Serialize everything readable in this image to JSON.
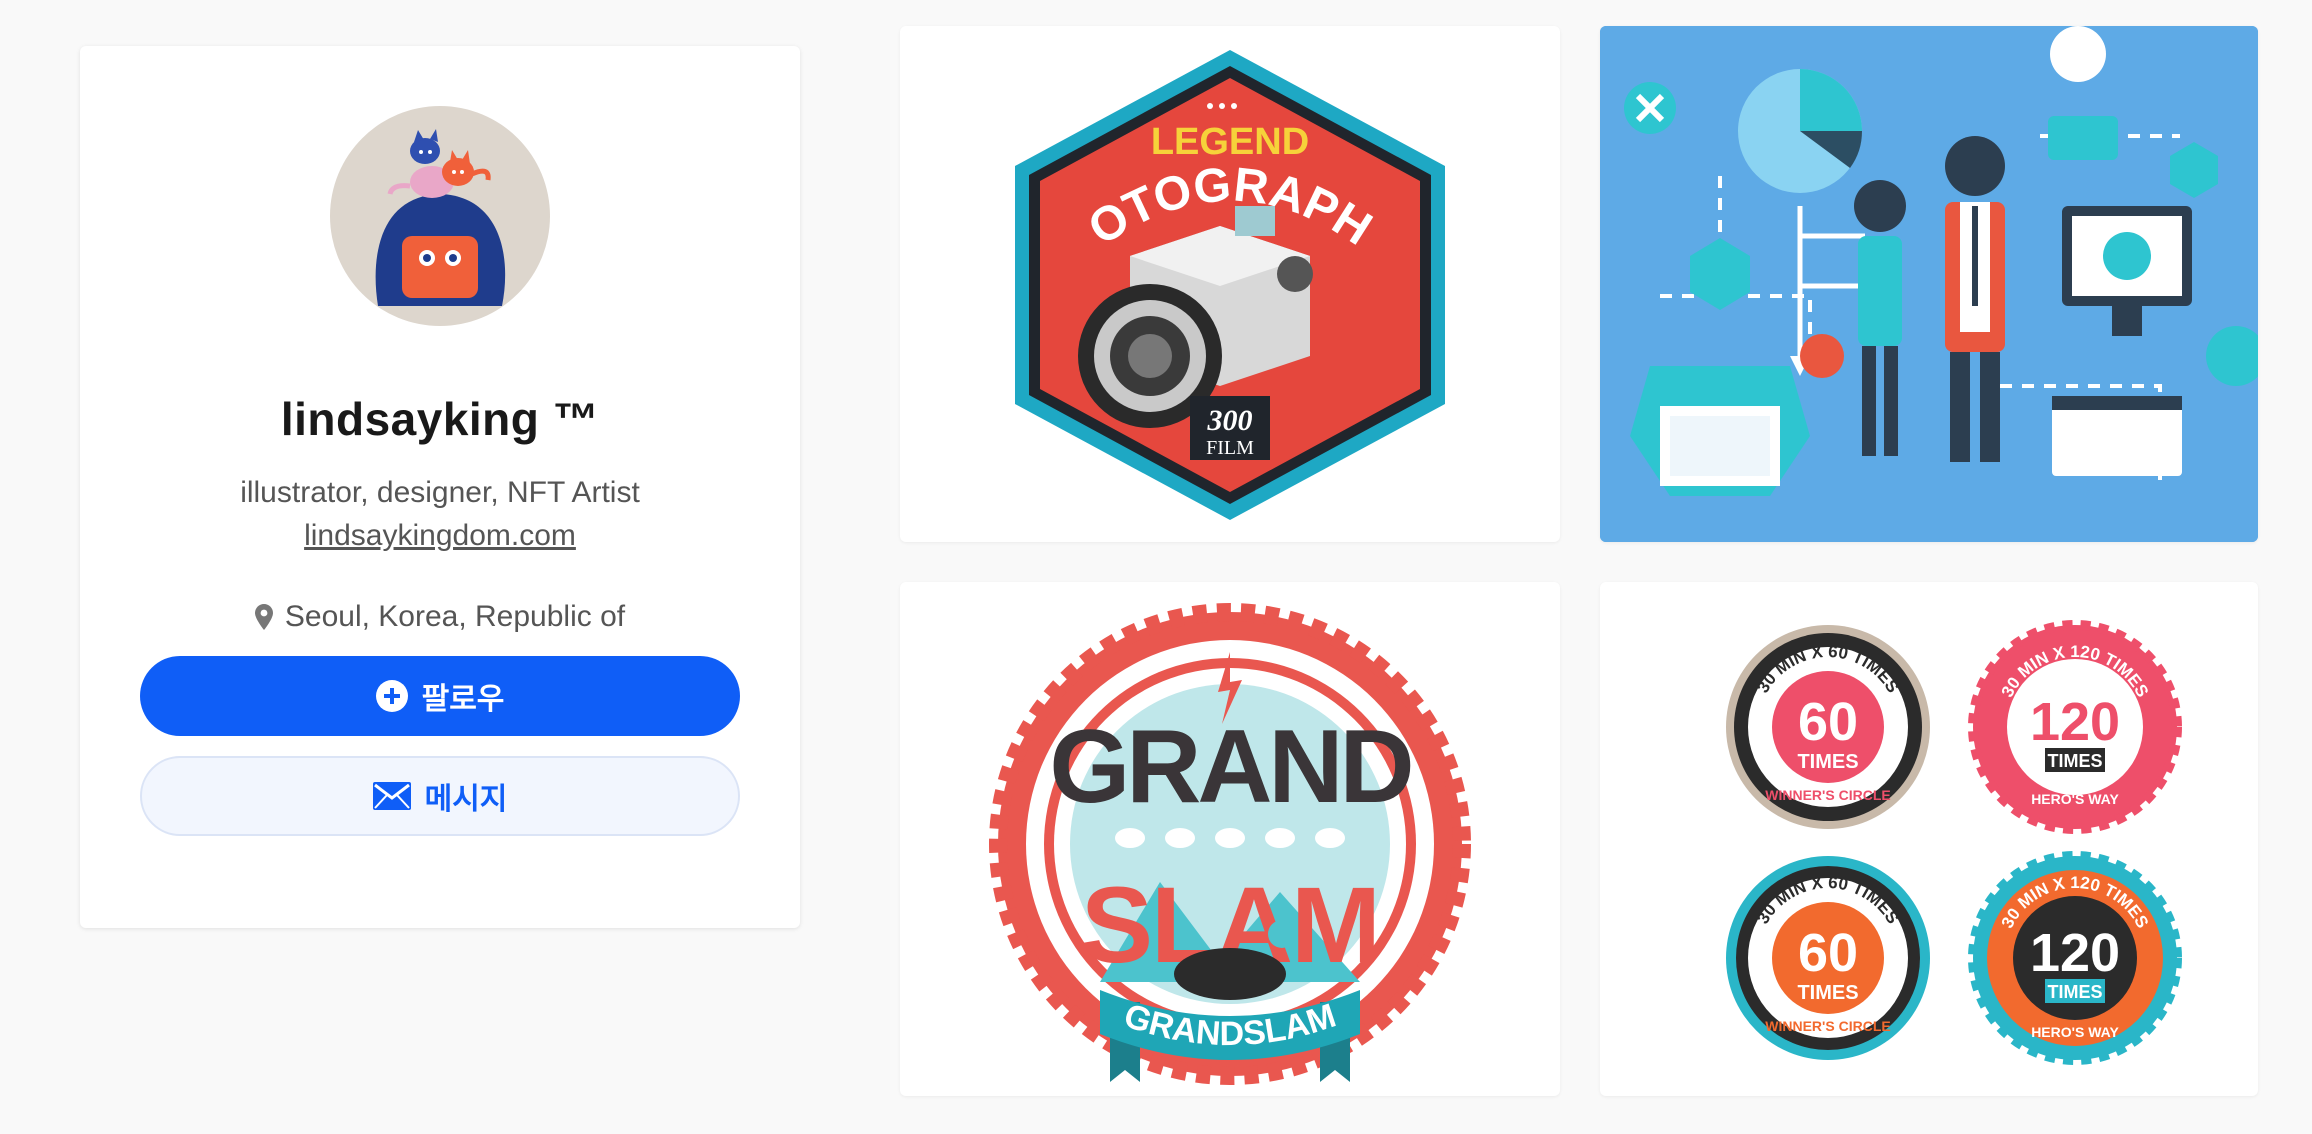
{
  "profile": {
    "name": "lindsayking ™",
    "bio": "illustrator, designer, NFT Artist",
    "website": "lindsaykingdom.com",
    "location": "Seoul, Korea, Republic of",
    "location_icon": "map-pin-icon",
    "follow_label": "팔로우",
    "follow_icon": "plus-circle-icon",
    "message_label": "메시지",
    "message_icon": "envelope-icon",
    "accent_color": "#0f5ef7"
  },
  "artworks": [
    {
      "label": "legend-photographer-badge",
      "texts": {
        "top": "LEGEND",
        "main": "PHOTOGRAPHER",
        "count": "300",
        "unit": "FILM"
      }
    },
    {
      "label": "flat-infographic-illustration"
    },
    {
      "label": "grand-slam-badge",
      "texts": {
        "line1": "GRAND",
        "line2": "SLAM",
        "ribbon": "GRANDSLAM"
      }
    },
    {
      "label": "times-badges",
      "badges": [
        {
          "arc": "30 MIN X 60 TIMES",
          "number": "60",
          "unit": "TIMES",
          "bottom": "WINNER'S CIRCLE"
        },
        {
          "arc": "30 MIN X 120 TIMES",
          "number": "120",
          "unit": "TIMES",
          "bottom": "HERO'S WAY"
        },
        {
          "arc": "30 MIN X 60 TIMES",
          "number": "60",
          "unit": "TIMES",
          "bottom": "WINNER'S CIRCLE"
        },
        {
          "arc": "30 MIN X 120 TIMES",
          "number": "120",
          "unit": "TIMES",
          "bottom": "HERO'S WAY"
        }
      ]
    }
  ]
}
